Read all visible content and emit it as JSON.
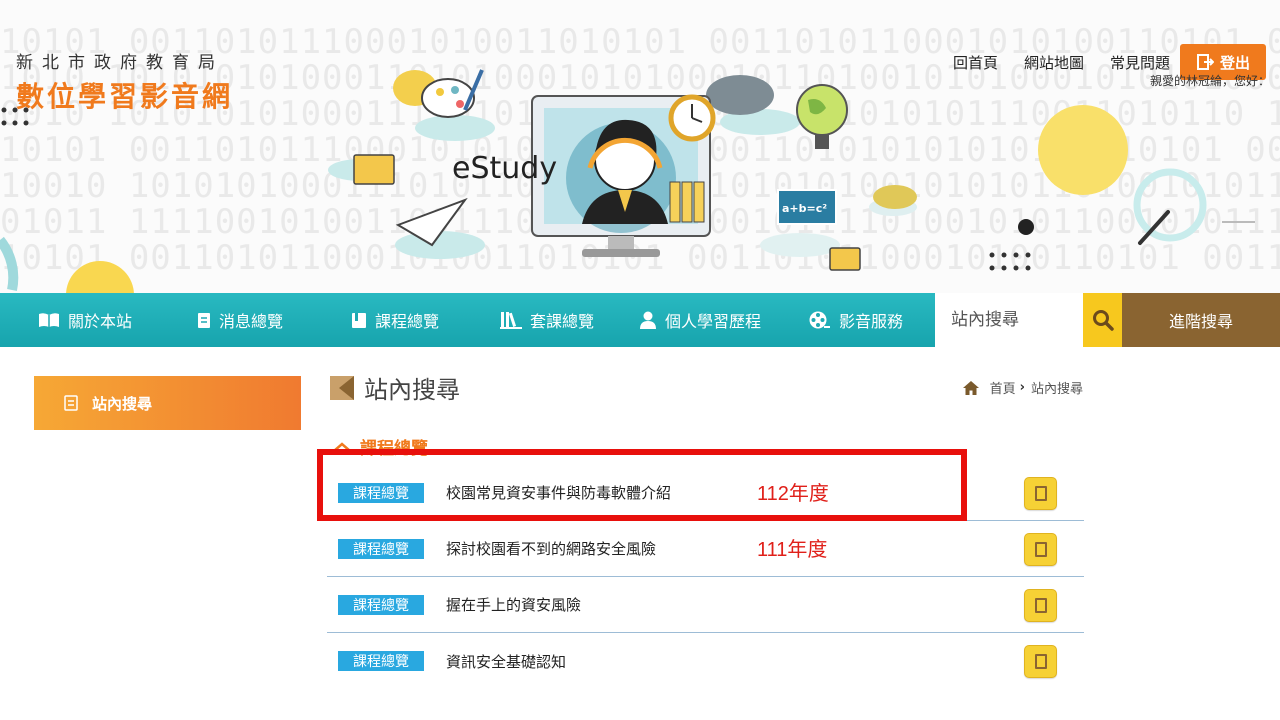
{
  "header": {
    "org_name": "新北市政府教育局",
    "site_name": "數位學習影音網",
    "banner_text": "eStudy",
    "banner_formula": "a+b=c²",
    "binary_lines": [
      "10101 00110101110001010011010101 0011010110001010100110101 00",
      "1010 10101010100011010100010101000101101001010100010101010001",
      "0010 1010101010001111010111100101001 101010101110011010110 10101",
      "10101 001101011100010101001101011001101010101010100110101 00110",
      "10010 1010101000111010110101010101010101001010101101001010110100",
      "01011 111100101001100111011101011001011110100101011001010111100",
      "10101 0011010110001010011010101 00110101100010100110101 0011010"
    ]
  },
  "toplinks": {
    "home": "回首頁",
    "sitemap": "網站地圖",
    "faq": "常見問題",
    "logout": "登出",
    "greeting": "親愛的林冠綸，您好："
  },
  "nav": {
    "items": [
      {
        "label": "關於本站",
        "icon": "book-icon"
      },
      {
        "label": "消息總覽",
        "icon": "document-icon"
      },
      {
        "label": "課程總覽",
        "icon": "notebook-icon"
      },
      {
        "label": "套課總覽",
        "icon": "library-icon"
      },
      {
        "label": "個人學習歷程",
        "icon": "person-icon"
      },
      {
        "label": "影音服務",
        "icon": "film-reel-icon"
      }
    ],
    "search_placeholder": "站內搜尋",
    "advanced_search": "進階搜尋"
  },
  "sidebar": {
    "active_item": "站內搜尋"
  },
  "main": {
    "page_title": "站內搜尋",
    "breadcrumb": {
      "home": "首頁",
      "current": "站內搜尋"
    },
    "section_title": "課程總覽",
    "results": [
      {
        "tag": "課程總覽",
        "title": "校園常見資安事件與防毒軟體介紹",
        "year_note": "112年度"
      },
      {
        "tag": "課程總覽",
        "title": "探討校園看不到的網路安全風險",
        "year_note": "111年度"
      },
      {
        "tag": "課程總覽",
        "title": "握在手上的資安風險",
        "year_note": ""
      },
      {
        "tag": "課程總覽",
        "title": "資訊安全基礎認知",
        "year_note": ""
      }
    ]
  },
  "colors": {
    "accent_orange": "#f07a1d",
    "nav_teal": "#17a4ad",
    "search_yellow": "#f7c81e",
    "advanced_brown": "#8a6431",
    "tag_blue": "#29a8e0",
    "annotation_red": "#e8100c"
  }
}
